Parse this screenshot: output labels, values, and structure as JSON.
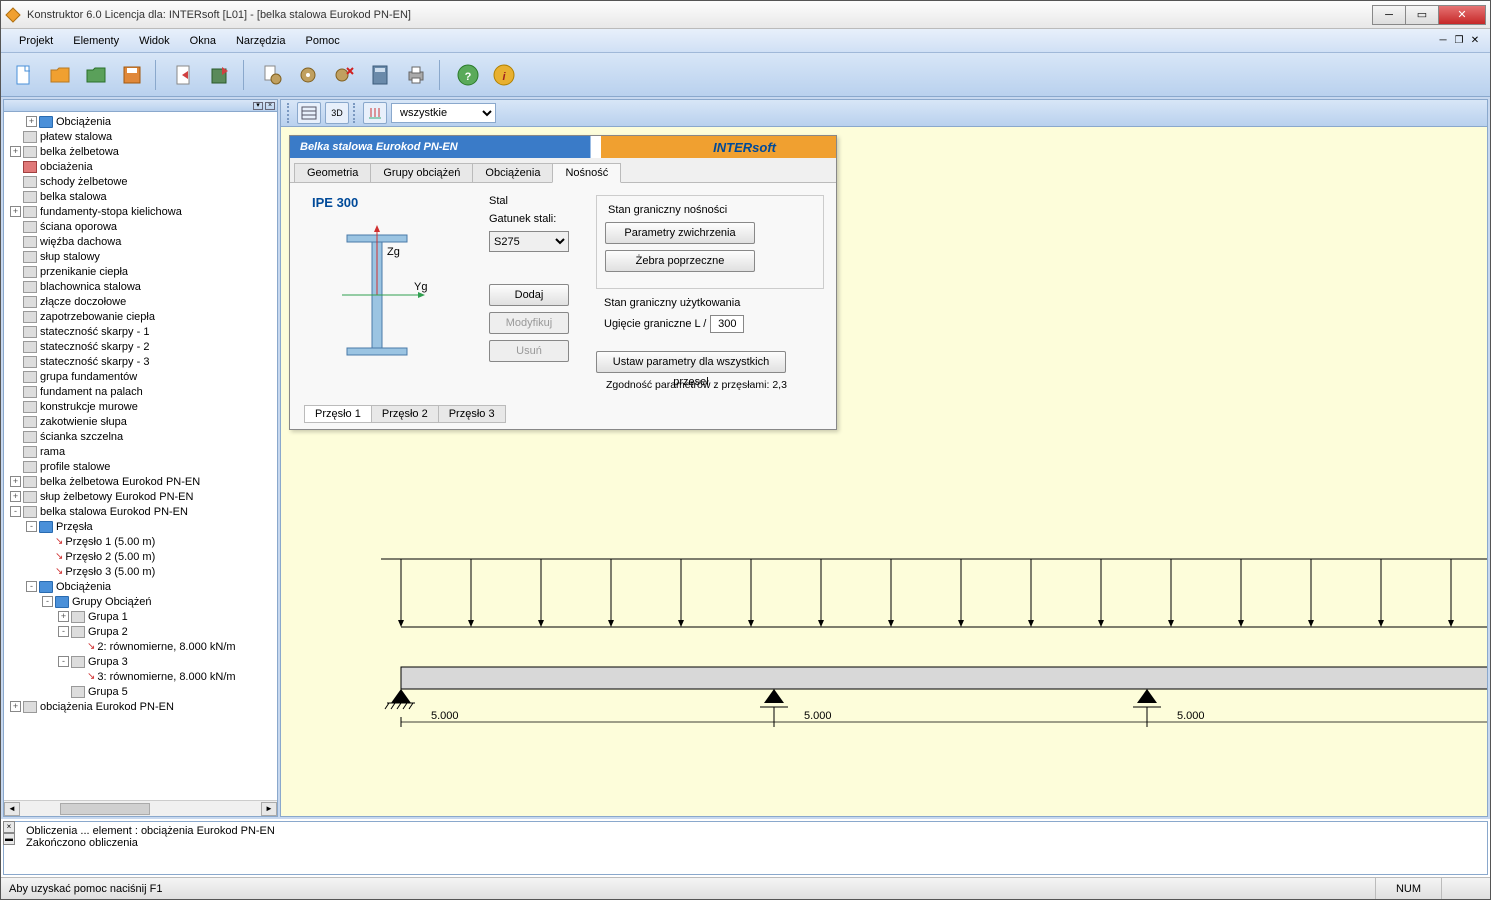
{
  "title": "Konstruktor 6.0 Licencja dla: INTERsoft [L01] - [belka stalowa Eurokod PN-EN]",
  "menu": [
    "Projekt",
    "Elementy",
    "Widok",
    "Okna",
    "Narzędzia",
    "Pomoc"
  ],
  "filter_select": "wszystkie",
  "tree": [
    {
      "d": 1,
      "e": "+",
      "i": "folder-blue",
      "t": "Obciążenia"
    },
    {
      "d": 0,
      "e": " ",
      "i": "item",
      "t": "płatew stalowa"
    },
    {
      "d": 0,
      "e": "+",
      "i": "item",
      "t": "belka żelbetowa"
    },
    {
      "d": 0,
      "e": " ",
      "i": "load",
      "t": "obciażenia"
    },
    {
      "d": 0,
      "e": " ",
      "i": "item",
      "t": "schody żelbetowe"
    },
    {
      "d": 0,
      "e": " ",
      "i": "item",
      "t": "belka stalowa"
    },
    {
      "d": 0,
      "e": "+",
      "i": "item",
      "t": "fundamenty-stopa kielichowa"
    },
    {
      "d": 0,
      "e": " ",
      "i": "item",
      "t": "ściana oporowa"
    },
    {
      "d": 0,
      "e": " ",
      "i": "item",
      "t": "więźba dachowa"
    },
    {
      "d": 0,
      "e": " ",
      "i": "item",
      "t": "słup stalowy"
    },
    {
      "d": 0,
      "e": " ",
      "i": "item",
      "t": "przenikanie ciepła"
    },
    {
      "d": 0,
      "e": " ",
      "i": "item",
      "t": "blachownica stalowa"
    },
    {
      "d": 0,
      "e": " ",
      "i": "item",
      "t": "złącze doczołowe"
    },
    {
      "d": 0,
      "e": " ",
      "i": "item",
      "t": "zapotrzebowanie ciepła"
    },
    {
      "d": 0,
      "e": " ",
      "i": "item",
      "t": "stateczność skarpy - 1"
    },
    {
      "d": 0,
      "e": " ",
      "i": "item",
      "t": "stateczność skarpy - 2"
    },
    {
      "d": 0,
      "e": " ",
      "i": "item",
      "t": "stateczność skarpy - 3"
    },
    {
      "d": 0,
      "e": " ",
      "i": "item",
      "t": "grupa fundamentów"
    },
    {
      "d": 0,
      "e": " ",
      "i": "item",
      "t": "fundament na palach"
    },
    {
      "d": 0,
      "e": " ",
      "i": "item",
      "t": "konstrukcje murowe"
    },
    {
      "d": 0,
      "e": " ",
      "i": "item",
      "t": "zakotwienie słupa"
    },
    {
      "d": 0,
      "e": " ",
      "i": "item",
      "t": "ścianka szczelna"
    },
    {
      "d": 0,
      "e": " ",
      "i": "item",
      "t": "rama"
    },
    {
      "d": 0,
      "e": " ",
      "i": "item",
      "t": "profile stalowe"
    },
    {
      "d": 0,
      "e": "+",
      "i": "item",
      "t": "belka żelbetowa Eurokod PN-EN"
    },
    {
      "d": 0,
      "e": "+",
      "i": "item",
      "t": "słup żelbetowy Eurokod PN-EN"
    },
    {
      "d": 0,
      "e": "-",
      "i": "item",
      "t": "belka stalowa Eurokod PN-EN"
    },
    {
      "d": 1,
      "e": "-",
      "i": "folder-blue",
      "t": "Przęsła"
    },
    {
      "d": 2,
      "e": " ",
      "i": "span",
      "t": "Przęsło 1 (5.00 m)",
      "arrow": true
    },
    {
      "d": 2,
      "e": " ",
      "i": "span",
      "t": "Przęsło 2 (5.00 m)",
      "arrow": true
    },
    {
      "d": 2,
      "e": " ",
      "i": "span",
      "t": "Przęsło 3 (5.00 m)",
      "arrow": true
    },
    {
      "d": 1,
      "e": "-",
      "i": "folder-blue",
      "t": "Obciążenia"
    },
    {
      "d": 2,
      "e": "-",
      "i": "folder-blue",
      "t": "Grupy Obciążeń"
    },
    {
      "d": 3,
      "e": "+",
      "i": "item",
      "t": "Grupa 1"
    },
    {
      "d": 3,
      "e": "-",
      "i": "item",
      "t": "Grupa 2"
    },
    {
      "d": 4,
      "e": " ",
      "i": "span",
      "t": "2: równomierne, 8.000 kN/m",
      "arrow": true
    },
    {
      "d": 3,
      "e": "-",
      "i": "item",
      "t": "Grupa 3"
    },
    {
      "d": 4,
      "e": " ",
      "i": "span",
      "t": "3: równomierne, 8.000 kN/m",
      "arrow": true
    },
    {
      "d": 3,
      "e": " ",
      "i": "item",
      "t": "Grupa 5"
    },
    {
      "d": 0,
      "e": "+",
      "i": "item",
      "t": "obciążenia Eurokod PN-EN"
    }
  ],
  "dialog": {
    "title": "Belka stalowa Eurokod PN-EN",
    "brand": "INTERsoft",
    "tabs": [
      "Geometria",
      "Grupy obciążeń",
      "Obciążenia",
      "Nośność"
    ],
    "active_tab": 3,
    "profile": "IPE 300",
    "axis_z": "Zg",
    "axis_y": "Yg",
    "steel_label": "Stal",
    "grade_label": "Gatunek stali:",
    "grade": "S275",
    "btn_add": "Dodaj",
    "btn_mod": "Modyfikuj",
    "btn_del": "Usuń",
    "uls_title": "Stan graniczny nośności",
    "btn_ltb": "Parametry zwichrzenia",
    "btn_ribs": "Żebra poprzeczne",
    "sls_title": "Stan graniczny użytkowania",
    "defl_label": "Ugięcie graniczne   L /",
    "defl_value": "300",
    "btn_all": "Ustaw parametry dla wszystkich przęseł",
    "compat": "Zgodność parametrów z przęsłami: 2,3",
    "span_tabs": [
      "Przęsło 1",
      "Przęsło 2",
      "Przęsło 3"
    ]
  },
  "beam": {
    "spans": [
      "5.000",
      "5.000",
      "5.000"
    ]
  },
  "log": {
    "l1": "Obliczenia ... element : obciążenia Eurokod PN-EN",
    "l2": "Zakończono obliczenia"
  },
  "status": {
    "help": "Aby uzyskać pomoc naciśnij F1",
    "num": "NUM"
  }
}
